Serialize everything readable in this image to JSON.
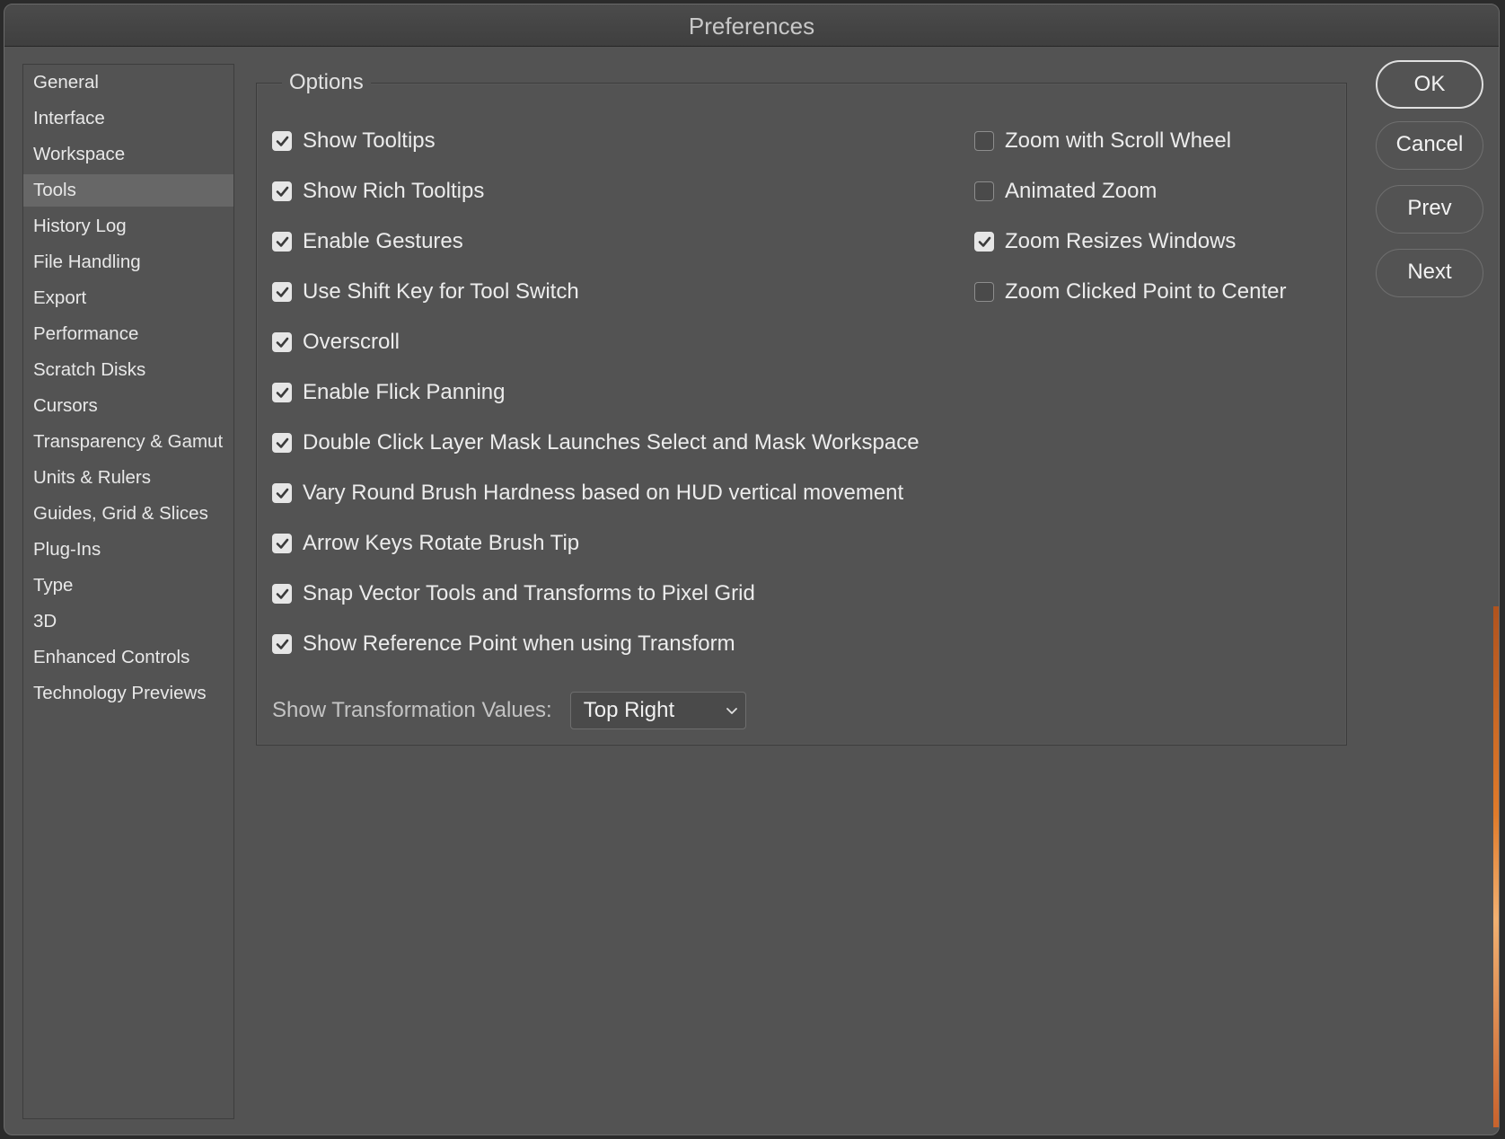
{
  "window": {
    "title": "Preferences"
  },
  "sidebar": {
    "items": [
      {
        "label": "General",
        "selected": false
      },
      {
        "label": "Interface",
        "selected": false
      },
      {
        "label": "Workspace",
        "selected": false
      },
      {
        "label": "Tools",
        "selected": true
      },
      {
        "label": "History Log",
        "selected": false
      },
      {
        "label": "File Handling",
        "selected": false
      },
      {
        "label": "Export",
        "selected": false
      },
      {
        "label": "Performance",
        "selected": false
      },
      {
        "label": "Scratch Disks",
        "selected": false
      },
      {
        "label": "Cursors",
        "selected": false
      },
      {
        "label": "Transparency & Gamut",
        "selected": false
      },
      {
        "label": "Units & Rulers",
        "selected": false
      },
      {
        "label": "Guides, Grid & Slices",
        "selected": false
      },
      {
        "label": "Plug-Ins",
        "selected": false
      },
      {
        "label": "Type",
        "selected": false
      },
      {
        "label": "3D",
        "selected": false
      },
      {
        "label": "Enhanced Controls",
        "selected": false
      },
      {
        "label": "Technology Previews",
        "selected": false
      }
    ]
  },
  "options": {
    "legend": "Options",
    "left": [
      {
        "label": "Show Tooltips",
        "checked": true
      },
      {
        "label": "Show Rich Tooltips",
        "checked": true
      },
      {
        "label": "Enable Gestures",
        "checked": true
      },
      {
        "label": "Use Shift Key for Tool Switch",
        "checked": true
      },
      {
        "label": "Overscroll",
        "checked": true
      },
      {
        "label": "Enable Flick Panning",
        "checked": true
      },
      {
        "label": "Double Click Layer Mask Launches Select and Mask Workspace",
        "checked": true
      },
      {
        "label": "Vary Round Brush Hardness based on HUD vertical movement",
        "checked": true
      },
      {
        "label": "Arrow Keys Rotate Brush Tip",
        "checked": true
      },
      {
        "label": "Snap Vector Tools and Transforms to Pixel Grid",
        "checked": true
      },
      {
        "label": "Show Reference Point when using Transform",
        "checked": true
      }
    ],
    "right": [
      {
        "label": "Zoom with Scroll Wheel",
        "checked": false
      },
      {
        "label": "Animated Zoom",
        "checked": false
      },
      {
        "label": "Zoom Resizes Windows",
        "checked": true
      },
      {
        "label": "Zoom Clicked Point to Center",
        "checked": false
      }
    ],
    "transformation": {
      "label": "Show Transformation Values:",
      "value": "Top Right"
    }
  },
  "buttons": {
    "ok": "OK",
    "cancel": "Cancel",
    "prev": "Prev",
    "next": "Next"
  },
  "colors": {
    "panel": "#535353",
    "selected_item": "#676767",
    "text": "#ececec"
  }
}
